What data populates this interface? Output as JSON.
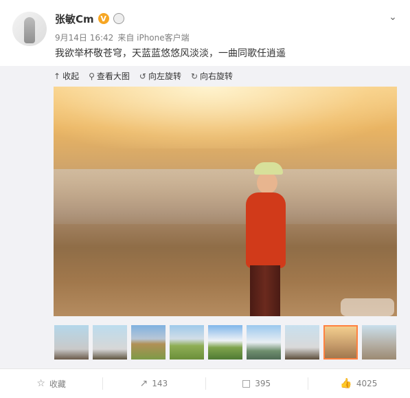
{
  "post": {
    "author": "张敏Cm",
    "verified_mark": "V",
    "date": "9月14日 16:42",
    "source": "来自 iPhone客户端",
    "text": "我欲举杯敬苍穹，天蓝蓝悠悠风淡淡，一曲同歌任逍遥",
    "menu_icon": "chevron-down-icon"
  },
  "media_toolbar": {
    "collapse": "收起",
    "view_large": "查看大图",
    "rotate_left": "向左旋转",
    "rotate_right": "向右旋转"
  },
  "thumbnails": {
    "count": 9,
    "selected_index": 7
  },
  "footer": {
    "favorite": "收藏",
    "forward_count": "143",
    "comment_count": "395",
    "like_count": "4025"
  },
  "colors": {
    "verified": "#f6a623",
    "selected_thumb_border": "#ff8140",
    "text": "#333333",
    "meta": "#808080"
  }
}
